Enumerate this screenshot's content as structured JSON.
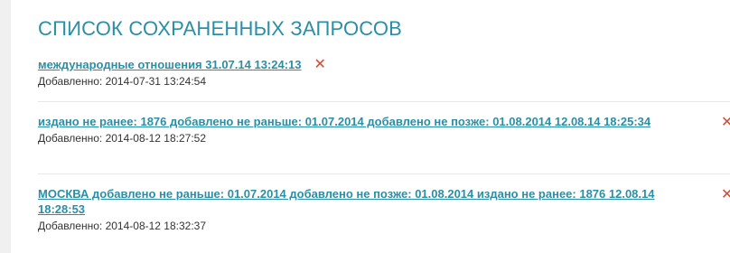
{
  "page": {
    "title": "СПИСОК СОХРАНЕННЫХ ЗАПРОСОВ",
    "delete_glyph": "✕"
  },
  "queries": [
    {
      "name": "международные отношения 31.07.14 13:24:13",
      "added": "Добавленно: 2014-07-31 13:24:54"
    },
    {
      "name": "издано не ранее: 1876 добавлено не раньше: 01.07.2014 добавлено не позже: 01.08.2014 12.08.14 18:25:34",
      "added": "Добавленно: 2014-08-12 18:27:52"
    },
    {
      "name": "МОСКВА добавлено не раньше: 01.07.2014 добавлено не позже: 01.08.2014 издано не ранее: 1876 12.08.14 18:28:53",
      "added": "Добавленно: 2014-08-12 18:32:37"
    }
  ],
  "colors": {
    "accent": "#2a8fa6",
    "delete": "#e0452c",
    "text": "#333333"
  },
  "icons": {
    "delete": "close-icon"
  }
}
